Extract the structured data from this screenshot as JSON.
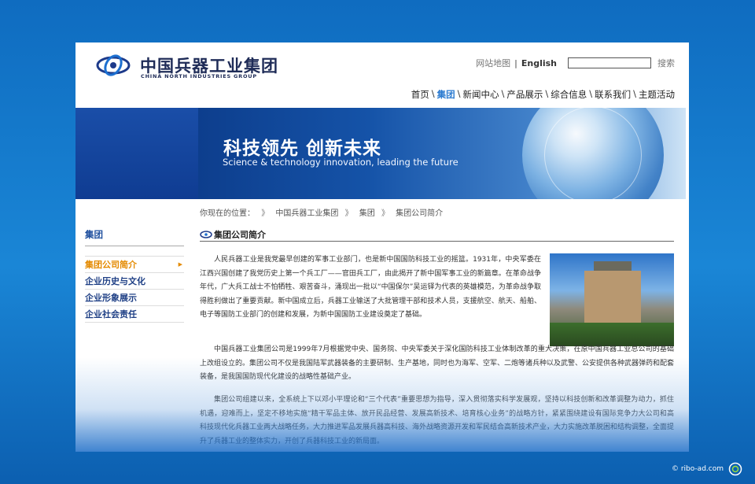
{
  "header": {
    "logo_cn": "中国兵器工业集团",
    "logo_en": "CHINA NORTH INDUSTRIES GROUP",
    "sitemap": "网站地图",
    "separator": "|",
    "english": "English",
    "search_placeholder": "",
    "search_button": "搜索"
  },
  "nav": {
    "items": [
      "首页",
      "集团",
      "新闻中心",
      "产品展示",
      "综合信息",
      "联系我们",
      "主题活动"
    ],
    "slash": "\\",
    "active_index": 1
  },
  "banner": {
    "title_cn": "科技领先  创新未来",
    "title_en": "Science & technology innovation, leading the future"
  },
  "breadcrumb": {
    "prefix": "你现在的位置：",
    "arrow": "》",
    "items": [
      "中国兵器工业集团",
      "集团",
      "集团公司简介"
    ]
  },
  "sidebar": {
    "title": "集团",
    "items": [
      {
        "label": "集团公司简介",
        "active": true,
        "marker": "▶"
      },
      {
        "label": "企业历史与文化",
        "active": false,
        "marker": ""
      },
      {
        "label": "企业形象展示",
        "active": false,
        "marker": ""
      },
      {
        "label": "企业社会责任",
        "active": false,
        "marker": ""
      }
    ]
  },
  "content": {
    "title": "集团公司简介",
    "paragraphs": [
      "人民兵器工业是我党最早创建的军事工业部门，也是新中国国防科技工业的摇篮。1931年，中央军委在江西兴国创建了我党历史上第一个兵工厂——官田兵工厂，由此揭开了新中国军事工业的新篇章。在革命战争年代，广大兵工战士不怕牺牲、艰苦奋斗，涌现出一批以“中国保尔”吴运铎为代表的英雄模范，为革命战争取得胜利做出了重要贡献。新中国成立后，兵器工业输送了大批管理干部和技术人员，支援航空、航天、船舶、电子等国防工业部门的创建和发展，为新中国国防工业建设奠定了基础。",
      "中国兵器工业集团公司是1999年7月根据党中央、国务院、中央军委关于深化国防科技工业体制改革的重大决策，在原中国兵器工业总公司的基础上改组设立的。集团公司不仅是我国陆军武器装备的主要研制、生产基地，同时也为海军、空军、二炮等诸兵种以及武警、公安提供各种武器弹药和配套装备，是我国国防现代化建设的战略性基础产业。",
      "集团公司组建以来，全系统上下以邓小平理论和“三个代表”重要思想为指导，深入贯彻落实科学发展观，坚持以科技创新和改革调整为动力，抓住机遇，迎难而上，坚定不移地实施“精干军品主体、放开民品经营、发展高新技术、培育核心业务”的战略方针，紧紧围绕建设有国际竞争力大公司和高科技现代化兵器工业两大战略任务，大力推进军品发展兵器高科技、海外战略资源开发和军民结合高新技术产业，大力实施改革脱困和结构调整，全面提升了兵器工业的整体实力，开创了兵器科技工业的新局面。"
    ]
  },
  "watermark": {
    "text": "© ribo-ad.com"
  },
  "colors": {
    "accent": "#2a7ad0",
    "active_side": "#e48a00",
    "brand": "#1e2b57"
  }
}
